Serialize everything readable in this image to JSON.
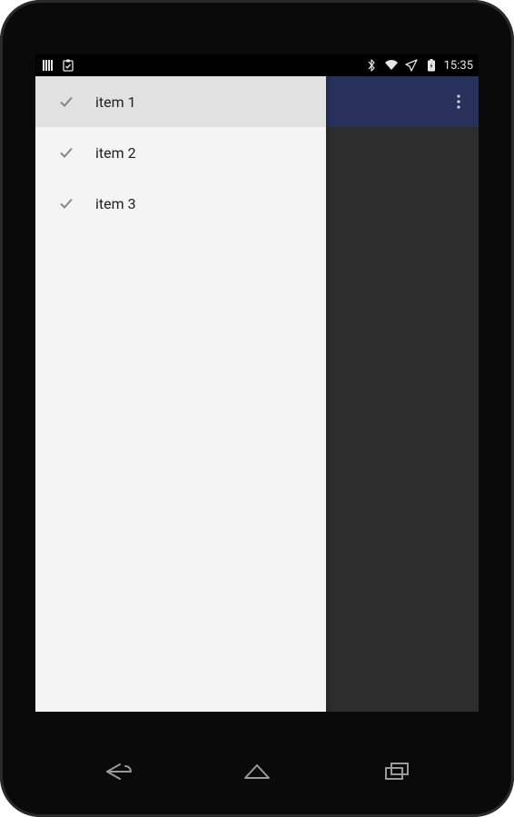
{
  "status": {
    "time": "15:35"
  },
  "menu": {
    "items": [
      {
        "label": "item 1",
        "selected": true
      },
      {
        "label": "item 2",
        "selected": false
      },
      {
        "label": "item 3",
        "selected": false
      }
    ]
  }
}
